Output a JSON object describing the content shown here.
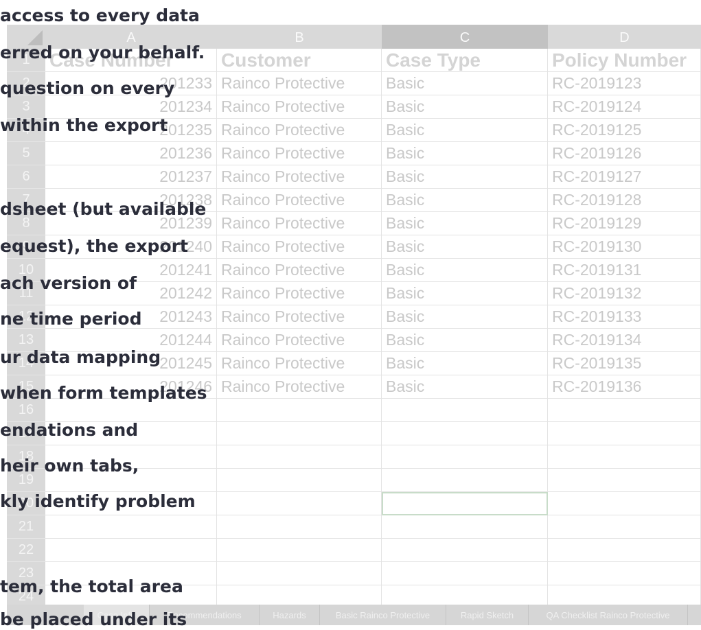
{
  "sheet": {
    "columns": [
      "A",
      "B",
      "C",
      "D"
    ],
    "selected_column": "C",
    "row_numbers": [
      "1",
      "2",
      "3",
      "4",
      "5",
      "6",
      "7",
      "8",
      "9",
      "10",
      "11",
      "12",
      "13",
      "14",
      "15",
      "16",
      "17",
      "18",
      "19",
      "20",
      "21",
      "22",
      "23",
      "24"
    ],
    "header_row": [
      "Case Number",
      "Customer",
      "Case Type",
      "Policy Number"
    ],
    "data_rows": [
      [
        "201233",
        "Rainco Protective",
        "Basic",
        "RC-2019123"
      ],
      [
        "201234",
        "Rainco Protective",
        "Basic",
        "RC-2019124"
      ],
      [
        "201235",
        "Rainco Protective",
        "Basic",
        "RC-2019125"
      ],
      [
        "201236",
        "Rainco Protective",
        "Basic",
        "RC-2019126"
      ],
      [
        "201237",
        "Rainco Protective",
        "Basic",
        "RC-2019127"
      ],
      [
        "201238",
        "Rainco Protective",
        "Basic",
        "RC-2019128"
      ],
      [
        "201239",
        "Rainco Protective",
        "Basic",
        "RC-2019129"
      ],
      [
        "201240",
        "Rainco Protective",
        "Basic",
        "RC-2019130"
      ],
      [
        "201241",
        "Rainco Protective",
        "Basic",
        "RC-2019131"
      ],
      [
        "201242",
        "Rainco Protective",
        "Basic",
        "RC-2019132"
      ],
      [
        "201243",
        "Rainco Protective",
        "Basic",
        "RC-2019133"
      ],
      [
        "201244",
        "Rainco Protective",
        "Basic",
        "RC-2019134"
      ],
      [
        "201245",
        "Rainco Protective",
        "Basic",
        "RC-2019135"
      ],
      [
        "201246",
        "Rainco Protective",
        "Basic",
        "RC-2019136"
      ]
    ],
    "tabs": [
      "Case Info",
      "Recommendations",
      "Hazards",
      "Basic Rainco Protective",
      "Rapid Sketch",
      "QA Checklist Rainco Protective"
    ],
    "active_tab": "Case Info"
  },
  "overlay_lines": [
    "access to every data",
    "erred on your behalf.",
    "question on every",
    "within the export",
    "",
    "dsheet (but available",
    "equest), the export",
    "ach version of",
    "ne time period",
    "ur data mapping",
    "when form templates",
    "endations and",
    "heir own tabs,",
    "kly identify problem",
    "",
    "",
    "tem, the total area",
    "be placed under its"
  ],
  "colors": {
    "header_gray": "#d9d9d9",
    "overlay_text": "#2b2d3a",
    "active_cell_border": "#c8dcc9"
  }
}
